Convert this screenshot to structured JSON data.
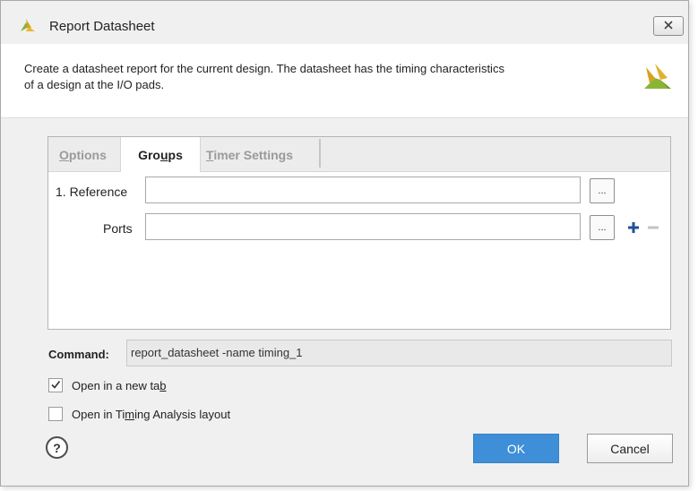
{
  "window": {
    "title": "Report Datasheet",
    "title_icon": "vivado-logo-icon",
    "close_icon": "close-icon"
  },
  "header": {
    "description_line1": "Create a datasheet report for the current design. The datasheet has the timing characteristics",
    "description_line2": "of a design at the I/O pads.",
    "logo_icon": "vivado-logo-icon"
  },
  "tabs": [
    {
      "label_pre": "",
      "label_ul": "O",
      "label_post": "ptions",
      "active": false
    },
    {
      "label_pre": "Gro",
      "label_ul": "u",
      "label_post": "ps",
      "active": true
    },
    {
      "label_pre": "",
      "label_ul": "T",
      "label_post": "imer Settings",
      "active": false
    }
  ],
  "groups": {
    "reference_label": "1. Reference",
    "reference_value": "",
    "ports_label": "Ports",
    "ports_value": "",
    "browse_label": "...",
    "add_icon": "plus-icon",
    "remove_icon": "minus-icon"
  },
  "command": {
    "label": "Command:",
    "value": "report_datasheet -name timing_1"
  },
  "options": {
    "open_new_tab": {
      "label_pre": "Open in a new ta",
      "label_ul": "b",
      "label_post": "",
      "checked": true
    },
    "open_timing_layout": {
      "label_pre": "Open in Ti",
      "label_ul": "m",
      "label_post": "ing Analysis layout",
      "checked": false
    }
  },
  "footer": {
    "help_label": "?",
    "ok_label": "OK",
    "cancel_label": "Cancel"
  },
  "colors": {
    "accent": "#3e8fd8",
    "logo_gold": "#d8a21c",
    "logo_green": "#8ab534"
  }
}
